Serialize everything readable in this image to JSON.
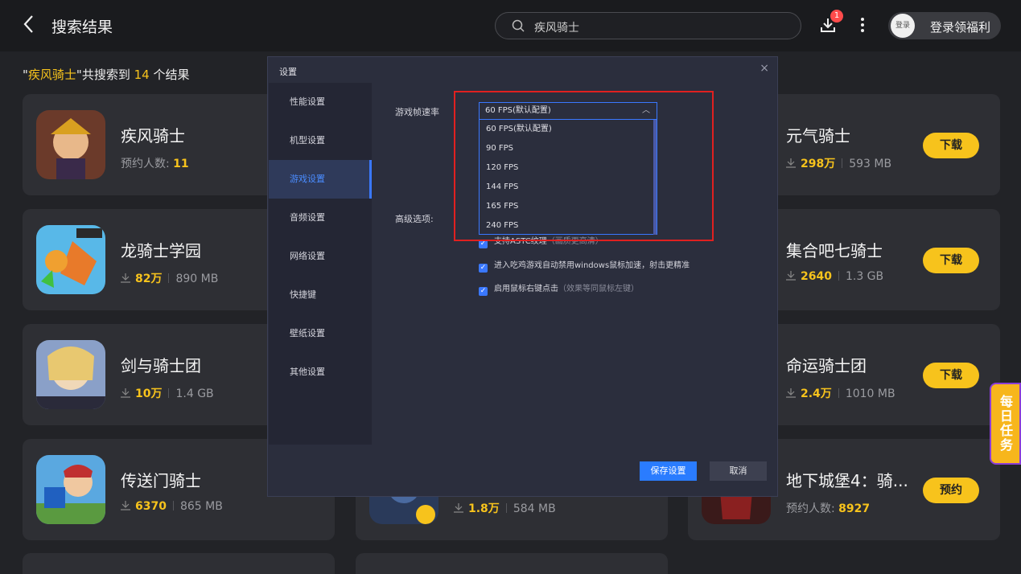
{
  "topbar": {
    "back_icon": "chevron-left-icon",
    "title": "搜索结果",
    "search_value": "疾风骑士",
    "download_badge": "1",
    "login_avatar": "登录",
    "login_label": "登录领福利"
  },
  "summary": {
    "quote_open": "\"",
    "keyword": "疾风骑士",
    "mid": "\"共搜索到 ",
    "count": "14",
    "tail": " 个结果"
  },
  "games": [
    {
      "name": "疾风骑士",
      "meta_label": "预约人数:",
      "meta_value": "11"
    },
    {
      "name": "元气骑士",
      "downloads": "298万",
      "size": "593 MB",
      "button": "下载"
    },
    {
      "name": "龙骑士学园",
      "downloads": "82万",
      "size": "890 MB"
    },
    {
      "name": "集合吧七骑士",
      "downloads": "2640",
      "size": "1.3 GB",
      "button": "下载"
    },
    {
      "name": "剑与骑士团",
      "downloads": "10万",
      "size": "1.4 GB"
    },
    {
      "name": "命运骑士团",
      "downloads": "2.4万",
      "size": "1010 MB",
      "button": "下载"
    },
    {
      "name": "传送门骑士",
      "downloads": "6370",
      "size": "865 MB"
    },
    {
      "name": "",
      "downloads": "1.8万",
      "size": "584 MB"
    },
    {
      "name": "地下城堡4：骑...",
      "meta_label": "预约人数:",
      "meta_value": "8927",
      "button": "预约"
    }
  ],
  "daily_task": "每日任务",
  "dialog": {
    "title": "设置",
    "close": "×",
    "sidebar": [
      "性能设置",
      "机型设置",
      "游戏设置",
      "音频设置",
      "网络设置",
      "快捷键",
      "壁纸设置",
      "其他设置"
    ],
    "active_index": 2,
    "fps_label": "游戏帧速率",
    "fps_value": "60 FPS(默认配置)",
    "fps_options": [
      "60 FPS(默认配置)",
      "90 FPS",
      "120 FPS",
      "144 FPS",
      "165 FPS",
      "240 FPS"
    ],
    "advanced_label": "高级选项:",
    "options": [
      {
        "label": "支持ASTC纹理",
        "note": "（画质更高清）",
        "checked": true
      },
      {
        "label": "进入吃鸡游戏自动禁用windows鼠标加速，射击更精准",
        "note": "",
        "checked": true
      },
      {
        "label": "启用鼠标右键点击",
        "note": "（效果等同鼠标左键）",
        "checked": true
      }
    ],
    "save_label": "保存设置",
    "cancel_label": "取消"
  },
  "colors": {
    "accent": "#f7c31c",
    "dialog_blue": "#3a78ff",
    "highlight_red": "#e02020"
  }
}
